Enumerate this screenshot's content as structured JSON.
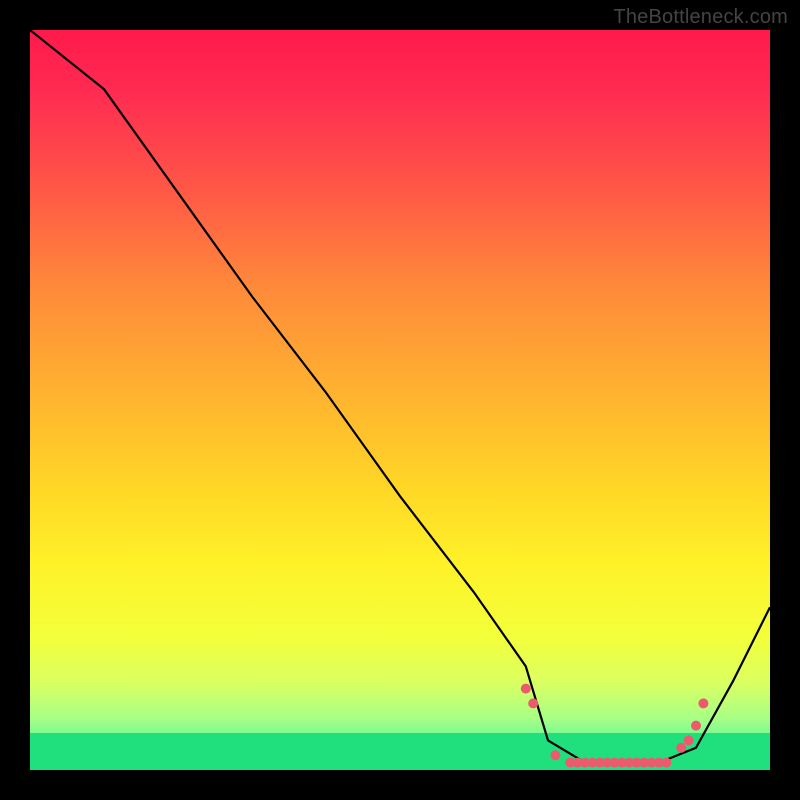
{
  "watermark": "TheBottleneck.com",
  "chart_data": {
    "type": "line",
    "title": "",
    "xlabel": "",
    "ylabel": "",
    "xlim": [
      0,
      100
    ],
    "ylim": [
      0,
      100
    ],
    "line": {
      "x": [
        0,
        10,
        20,
        30,
        40,
        50,
        60,
        67,
        70,
        75,
        80,
        85,
        90,
        95,
        100
      ],
      "y": [
        100,
        92,
        78,
        64,
        51,
        37,
        24,
        14,
        4,
        1,
        1,
        1,
        3,
        12,
        22
      ]
    },
    "markers": {
      "x": [
        67,
        68,
        71,
        73,
        74,
        75,
        76,
        77,
        78,
        79,
        80,
        81,
        82,
        83,
        84,
        85,
        86,
        88,
        89,
        90,
        91
      ],
      "y": [
        11,
        9,
        2,
        1,
        1,
        1,
        1,
        1,
        1,
        1,
        1,
        1,
        1,
        1,
        1,
        1,
        1,
        3,
        4,
        6,
        9
      ],
      "color": "#ec5a6e",
      "size": 5
    },
    "gradient_stops": [
      {
        "offset": 0.0,
        "color": "#ff1a4b"
      },
      {
        "offset": 0.08,
        "color": "#ff2a52"
      },
      {
        "offset": 0.2,
        "color": "#ff5248"
      },
      {
        "offset": 0.35,
        "color": "#ff8a3a"
      },
      {
        "offset": 0.5,
        "color": "#ffb52f"
      },
      {
        "offset": 0.62,
        "color": "#ffd726"
      },
      {
        "offset": 0.72,
        "color": "#fff128"
      },
      {
        "offset": 0.82,
        "color": "#f3ff3a"
      },
      {
        "offset": 0.88,
        "color": "#dcff60"
      },
      {
        "offset": 0.93,
        "color": "#a8ff86"
      },
      {
        "offset": 0.97,
        "color": "#58f59a"
      },
      {
        "offset": 1.0,
        "color": "#17e07f"
      }
    ],
    "green_band": {
      "from": 0.95,
      "to": 1.0,
      "color": "#20e07d"
    }
  }
}
